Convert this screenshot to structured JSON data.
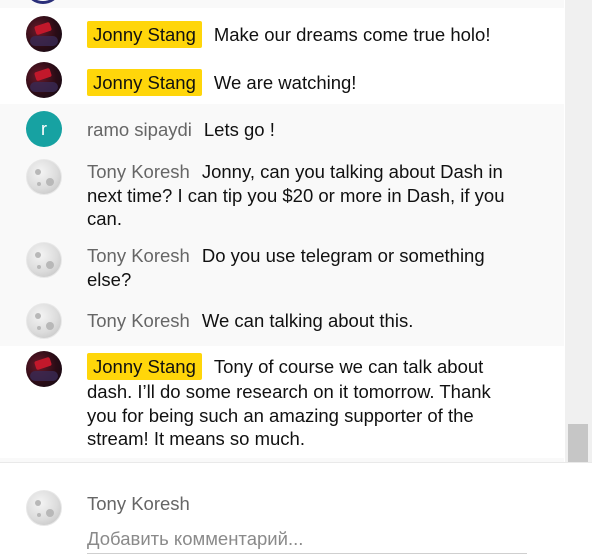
{
  "messages": [
    {
      "author": "Jonny Stang",
      "text": "Make our dreams come true holo!",
      "owner": true
    },
    {
      "author": "Jonny Stang",
      "text": "We are watching!",
      "owner": true
    },
    {
      "author": "ramo sipaydi",
      "avatar_letter": "r",
      "text": "Lets go !",
      "owner": false
    },
    {
      "author": "Tony Koresh",
      "text": "Jonny, can you talking about Dash in next time? I can tip you $20 or more in Dash, if you can.",
      "owner": false
    },
    {
      "author": "Tony Koresh",
      "text": "Do you use telegram or something else?",
      "owner": false
    },
    {
      "author": "Tony Koresh",
      "text": "We can talking about this.",
      "owner": false
    },
    {
      "author": "Jonny Stang",
      "text": "Tony of course we can talk about dash. I’ll do some research on it tomorrow. Thank you for being such an amazing supporter of the stream! It means so much.",
      "owner": true
    }
  ],
  "composer": {
    "user_name": "Tony Koresh",
    "placeholder": "Добавить комментарий..."
  },
  "colors": {
    "owner_badge": "#ffd60a",
    "avatar_teal": "#17a2a2",
    "list_background": "#f9f9f9"
  }
}
